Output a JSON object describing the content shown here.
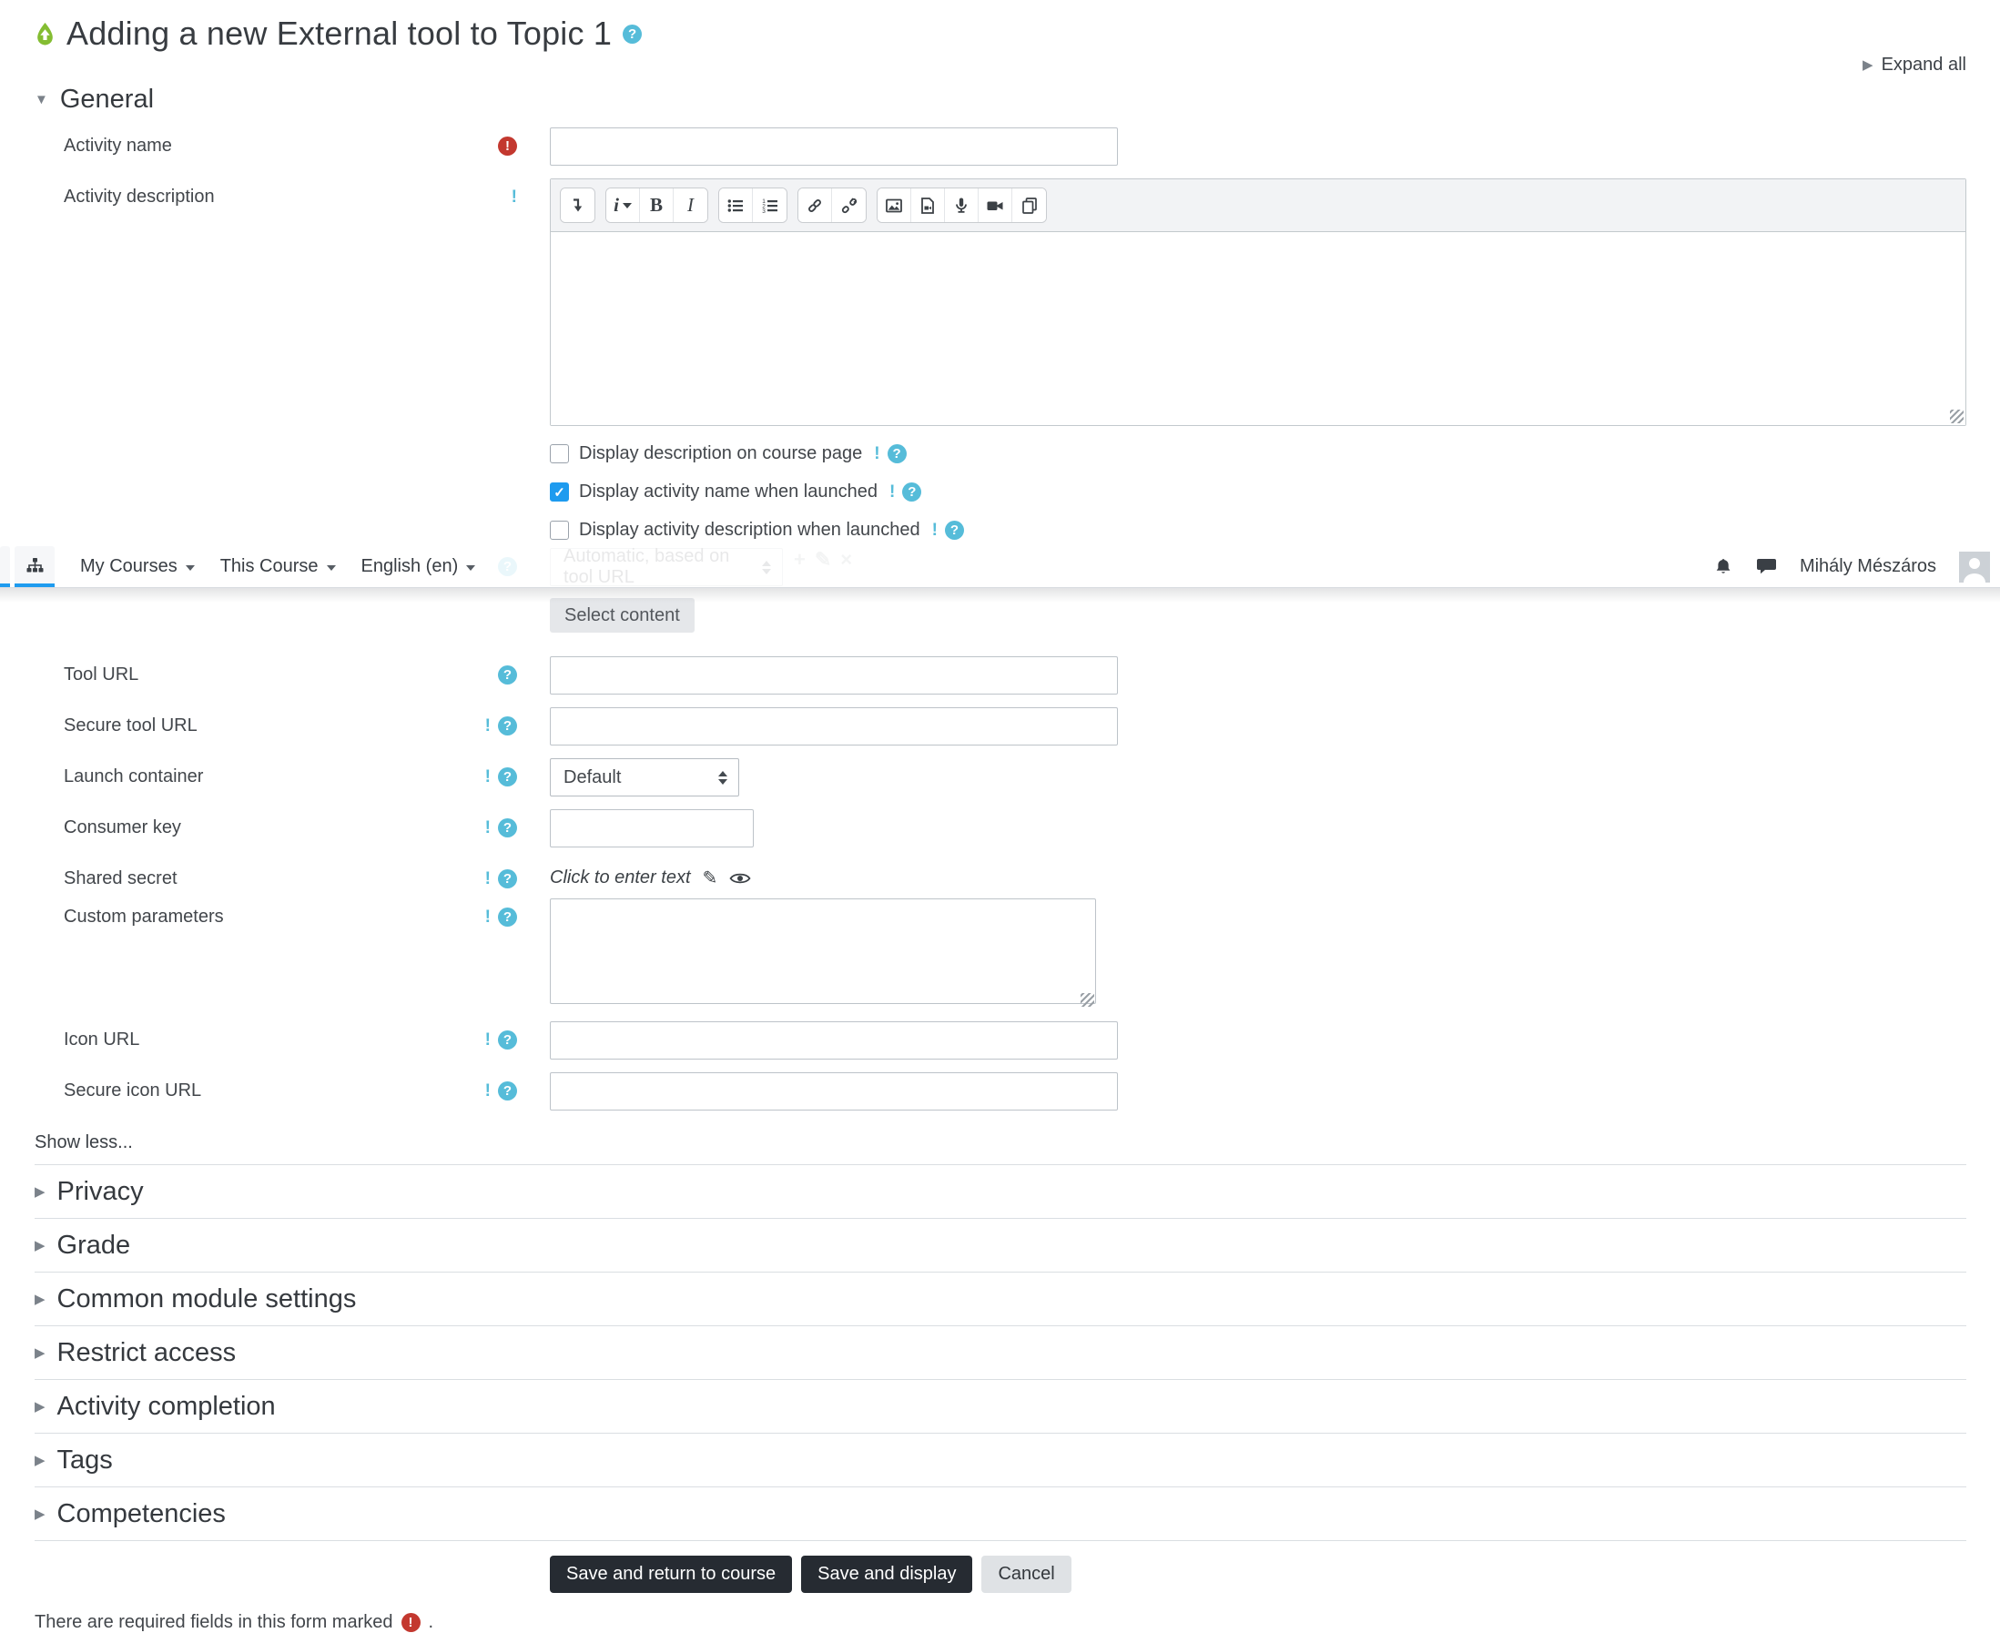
{
  "page": {
    "title": "Adding a new External tool to Topic 1",
    "expand_all": "Expand all",
    "required_note": "There are required fields in this form marked",
    "required_note_period": "."
  },
  "navbar": {
    "items": [
      "My Courses",
      "This Course",
      "English (en)"
    ],
    "user_name": "Mihály Mészáros",
    "icons": [
      "sitemap-icon",
      "notifications-bell-icon",
      "messages-icon",
      "user-avatar"
    ]
  },
  "general": {
    "heading": "General",
    "activity_name_label": "Activity name",
    "activity_description_label": "Activity description",
    "activity_name_value": "",
    "activity_description_value": "",
    "checkboxes": [
      {
        "label": "Display description on course page",
        "checked": false
      },
      {
        "label": "Display activity name when launched",
        "checked": true
      },
      {
        "label": "Display activity description when launched",
        "checked": false
      }
    ],
    "preconfigured_tool_value": "Automatic, based on tool URL",
    "select_content": "Select content",
    "tool_url_label": "Tool URL",
    "tool_url_value": "",
    "secure_tool_url_label": "Secure tool URL",
    "secure_tool_url_value": "",
    "launch_container_label": "Launch container",
    "launch_container_value": "Default",
    "consumer_key_label": "Consumer key",
    "consumer_key_value": "",
    "shared_secret_label": "Shared secret",
    "shared_secret_placeholder": "Click to enter text",
    "custom_parameters_label": "Custom parameters",
    "custom_parameters_value": "",
    "icon_url_label": "Icon URL",
    "icon_url_value": "",
    "secure_icon_url_label": "Secure icon URL",
    "secure_icon_url_value": "",
    "show_less": "Show less..."
  },
  "sections": [
    "Privacy",
    "Grade",
    "Common module settings",
    "Restrict access",
    "Activity completion",
    "Tags",
    "Competencies"
  ],
  "buttons": {
    "save_return": "Save and return to course",
    "save_display": "Save and display",
    "cancel": "Cancel"
  },
  "editor_toolbar_icons": [
    "collapse-toolbar-icon",
    "paragraph-styles-icon",
    "bold-icon",
    "italic-icon",
    "unordered-list-icon",
    "ordered-list-icon",
    "link-icon",
    "unlink-icon",
    "insert-image-icon",
    "insert-media-icon",
    "record-audio-icon",
    "record-video-icon",
    "manage-files-icon"
  ],
  "glyphs": {
    "question": "?",
    "exclamation": "!",
    "check": "✓",
    "triangle_right": "▶",
    "triangle_down": "▼",
    "pencil": "✎",
    "plus": "+",
    "cross": "×",
    "bold": "B",
    "italic": "I",
    "styles": "i"
  },
  "colors": {
    "primary_blue": "#1e9bef",
    "help_blue": "#56bcd9",
    "required_red": "#c3382f",
    "dark_button": "#262b32",
    "activity_icon_green": "#84bd32"
  }
}
